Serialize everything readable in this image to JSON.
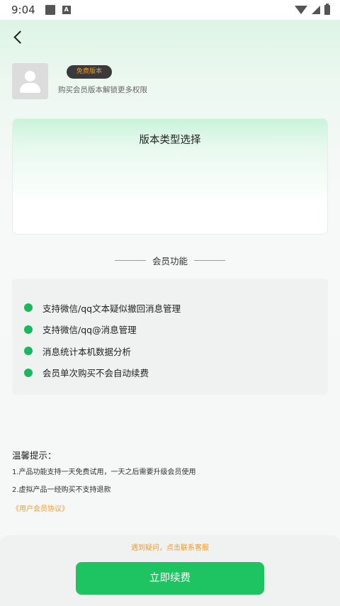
{
  "status_bar": {
    "time": "9:04",
    "icons": [
      "notification-square-icon",
      "a-icon",
      "wifi-icon",
      "signal-icon",
      "battery-icon"
    ]
  },
  "header": {
    "back_icon": "chevron-left-icon"
  },
  "user": {
    "avatar_icon": "person-icon",
    "badge": "免费版本",
    "description": "购买会员版本解锁更多权限"
  },
  "plan_card": {
    "title": "版本类型选择"
  },
  "features_section": {
    "title": "会员功能",
    "items": [
      "支持微信/qq文本疑似撤回消息管理",
      "支持微信/qq@消息管理",
      "消息统计本机数据分析",
      "会员单次购买不会自动续费"
    ]
  },
  "tips": {
    "title": "温馨提示：",
    "items": [
      "1.产品功能支持一天免费试用，一天之后需要升级会员使用",
      "2.虚拟产品一经购买不支持退款"
    ],
    "agreement_link": "《用户会员协议》"
  },
  "footer": {
    "contact_text": "遇到疑问，点击联系客服",
    "renew_button": "立即续费"
  },
  "colors": {
    "accent_green": "#1ec362",
    "dot_green": "#19b85e",
    "link_orange": "#f39a2b",
    "badge_bg": "#3a3a3a"
  }
}
